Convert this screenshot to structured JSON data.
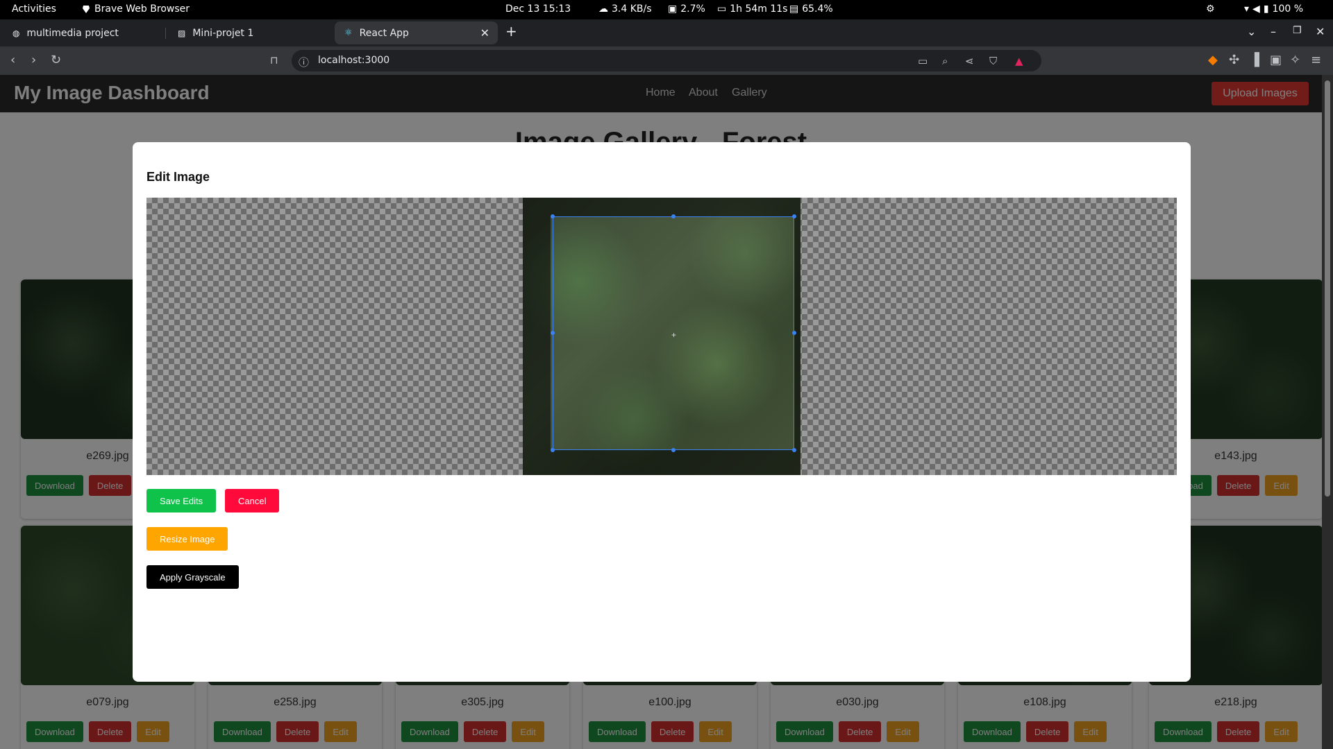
{
  "system_bar": {
    "activities": "Activities",
    "app_name": "Brave Web Browser",
    "datetime": "Dec 13  15:13",
    "network": "3.4 KB/s",
    "cpu": "2.7%",
    "uptime": "1h 54m 11s",
    "memory": "65.4%",
    "battery": "100 %"
  },
  "tabs": [
    {
      "title": "multimedia project",
      "icon": "globe-icon"
    },
    {
      "title": "Mini-projet 1",
      "icon": "image-icon"
    },
    {
      "title": "React App",
      "icon": "react-icon",
      "active": true
    }
  ],
  "browser": {
    "url": "localhost:3000"
  },
  "app": {
    "brand": "My Image Dashboard",
    "nav": [
      "Home",
      "About",
      "Gallery"
    ],
    "upload_label": "Upload Images",
    "gallery_title": "Image Gallery - Forest",
    "card_actions": {
      "download": "Download",
      "delete": "Delete",
      "edit": "Edit"
    },
    "cards": [
      {
        "name": "e269.jpg",
        "tone": "#1f3320"
      },
      {
        "name": "e143.jpg",
        "tone": "#233a22"
      },
      {
        "name": "e079.jpg",
        "tone": "#2e4a2b"
      },
      {
        "name": "e258.jpg",
        "tone": "#27402a"
      },
      {
        "name": "e305.jpg",
        "tone": "#2a4228"
      },
      {
        "name": "e100.jpg",
        "tone": "#263d25"
      },
      {
        "name": "e030.jpg",
        "tone": "#2b4429"
      },
      {
        "name": "e108.jpg",
        "tone": "#243b24"
      },
      {
        "name": "e218.jpg",
        "tone": "#1e321f"
      }
    ]
  },
  "modal": {
    "title": "Edit Image",
    "save_label": "Save Edits",
    "cancel_label": "Cancel",
    "resize_label": "Resize Image",
    "grayscale_label": "Apply Grayscale"
  },
  "colors": {
    "save": "#0ec24a",
    "cancel": "#ff0a3b",
    "resize": "#ffa500",
    "grayscale": "#000000",
    "crop_border": "#3b82f6"
  }
}
